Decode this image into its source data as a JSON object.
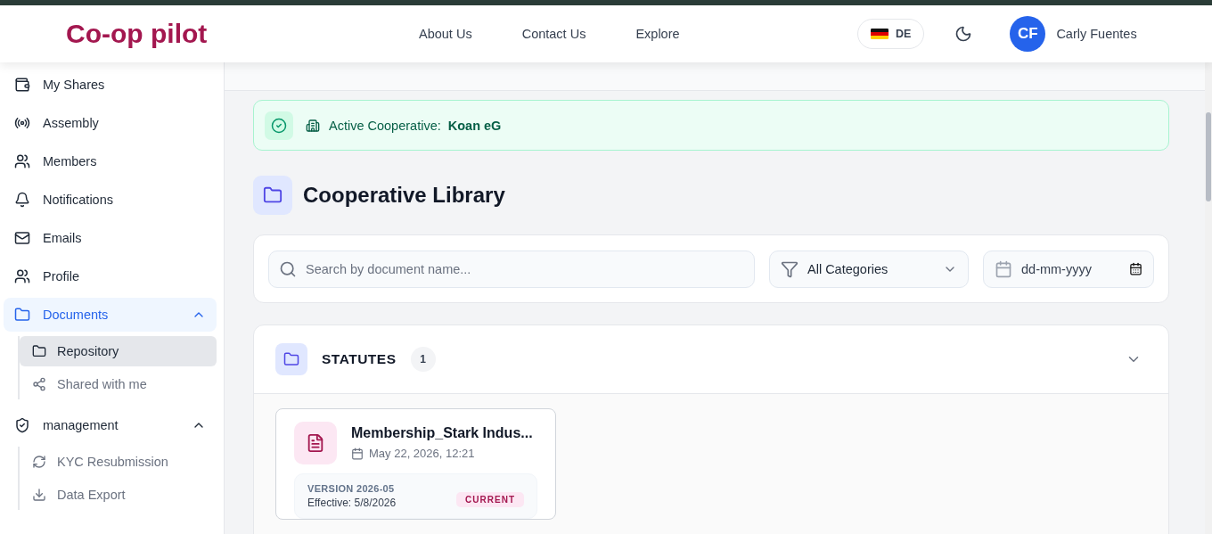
{
  "header": {
    "logo": "Co-op pilot",
    "nav": [
      {
        "label": "About Us"
      },
      {
        "label": "Contact Us"
      },
      {
        "label": "Explore"
      }
    ],
    "language": "DE",
    "user": {
      "initials": "CF",
      "name": "Carly Fuentes"
    }
  },
  "sidebar": {
    "items": [
      {
        "kind": "link",
        "label": "My Shares"
      },
      {
        "kind": "link",
        "label": "Assembly"
      },
      {
        "kind": "link",
        "label": "Members"
      },
      {
        "kind": "link",
        "label": "Notifications"
      },
      {
        "kind": "link",
        "label": "Emails"
      },
      {
        "kind": "link",
        "label": "Profile"
      },
      {
        "kind": "group",
        "label": "Documents",
        "selected": true,
        "expanded": true,
        "children": [
          {
            "label": "Repository",
            "selected": true
          },
          {
            "label": "Shared with me",
            "selected": false
          }
        ]
      },
      {
        "kind": "group",
        "label": "management",
        "selected": false,
        "expanded": true,
        "children": [
          {
            "label": "KYC Resubmission",
            "selected": false
          },
          {
            "label": "Data Export",
            "selected": false
          }
        ]
      }
    ]
  },
  "banner": {
    "label": "Active Cooperative:",
    "value": "Koan eG"
  },
  "page_title": "Cooperative Library",
  "filters": {
    "search": {
      "placeholder": "Search by document name..."
    },
    "category": "All Categories",
    "date": {
      "placeholder": "dd-mm-yyyy"
    }
  },
  "sections": [
    {
      "title": "STATUTES",
      "count": "1",
      "expanded": true,
      "documents": [
        {
          "name": "Membership_Stark Indus...",
          "date": "May 22, 2026, 12:21",
          "version": "VERSION 2026-05",
          "effective": "Effective: 5/8/2026",
          "status": "CURRENT"
        }
      ]
    }
  ]
}
